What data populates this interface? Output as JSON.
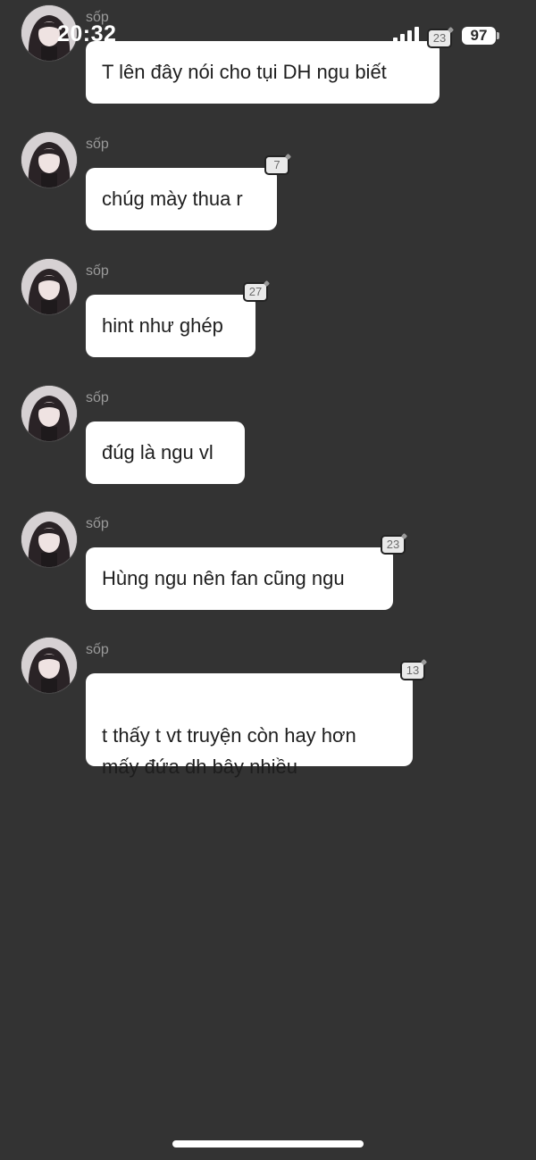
{
  "status_bar": {
    "time": "20:32",
    "battery": "97"
  },
  "messages": [
    {
      "sender": "sốp",
      "text": "T lên đây nói cho tụi DH ngu biết",
      "reply_count": "23"
    },
    {
      "sender": "sốp",
      "text": "chúg mày thua r",
      "reply_count": "7"
    },
    {
      "sender": "sốp",
      "text": "hint như ghép",
      "reply_count": "27"
    },
    {
      "sender": "sốp",
      "text": "đúg là ngu vl",
      "reply_count": ""
    },
    {
      "sender": "sốp",
      "text": "Hùng ngu nên fan cũng ngu",
      "reply_count": "23"
    },
    {
      "sender": "sốp",
      "text": "t thấy t vt truyện còn hay hơn\nmấy đứa dh bây nhiều",
      "reply_count": "13"
    }
  ],
  "icons": {
    "signal": "signal-icon",
    "battery": "battery-icon",
    "avatar": "avatar-icon"
  },
  "colors": {
    "background": "#333333",
    "bubble": "#ffffff",
    "sender": "#9a9a9a"
  }
}
